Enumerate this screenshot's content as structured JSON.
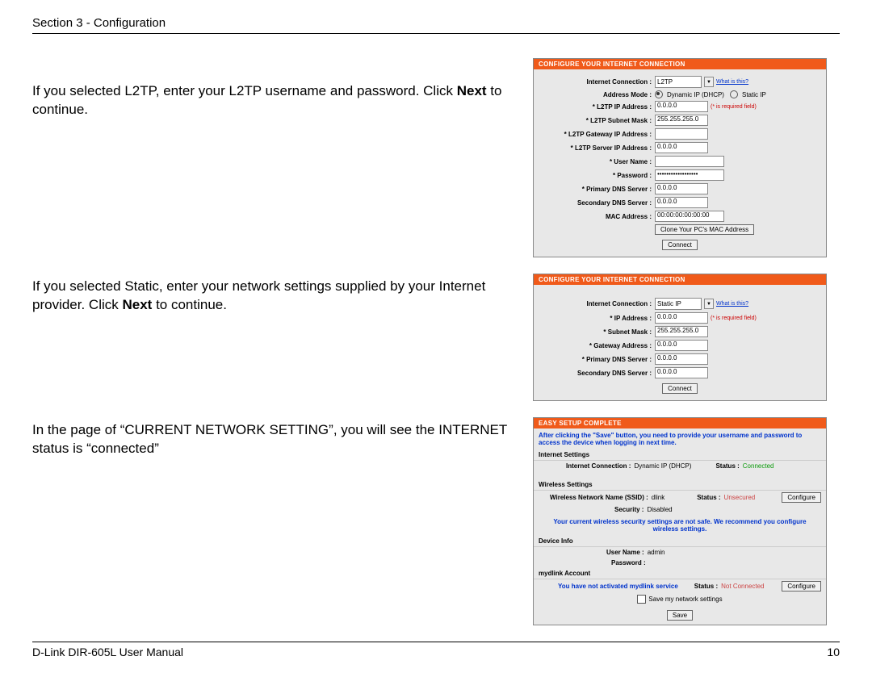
{
  "header": {
    "section": "Section 3 - Configuration"
  },
  "footer": {
    "manual": "D-Link DIR-605L User Manual",
    "page": "10"
  },
  "instructions": {
    "l2tp_a": "If you selected L2TP, enter your L2TP username and password. Click ",
    "l2tp_b": "Next",
    "l2tp_c": " to continue.",
    "static_a": "If you selected Static, enter your network settings supplied by your Internet provider. Click ",
    "static_b": "Next",
    "static_c": " to continue.",
    "current": "In the page of “CURRENT NETWORK SETTING”, you will see the INTERNET status is “connected”"
  },
  "panel1": {
    "title": "CONFIGURE YOUR INTERNET CONNECTION",
    "labels": {
      "internet_connection": "Internet Connection :",
      "address_mode": "Address Mode :",
      "l2tp_ip": "* L2TP IP Address :",
      "l2tp_subnet": "* L2TP Subnet Mask :",
      "l2tp_gateway": "* L2TP Gateway IP Address :",
      "l2tp_server": "* L2TP Server IP Address :",
      "username": "* User Name :",
      "password": "* Password :",
      "primary_dns": "* Primary DNS Server :",
      "secondary_dns": "Secondary DNS Server :",
      "mac": "MAC Address :"
    },
    "values": {
      "internet_connection": "L2TP",
      "what_is_this": "What is this?",
      "dynamic_ip": "Dynamic IP (DHCP)",
      "static_ip": "Static IP",
      "l2tp_ip": "0.0.0.0",
      "required": "(* is required field)",
      "l2tp_subnet": "255.255.255.0",
      "l2tp_gateway": "",
      "l2tp_server": "0.0.0.0",
      "username": "",
      "password": "••••••••••••••••••",
      "primary_dns": "0.0.0.0",
      "secondary_dns": "0.0.0.0",
      "mac": "00:00:00:00:00:00",
      "clone_btn": "Clone Your PC's MAC Address",
      "connect_btn": "Connect"
    }
  },
  "panel2": {
    "title": "CONFIGURE YOUR INTERNET CONNECTION",
    "labels": {
      "internet_connection": "Internet Connection :",
      "ip": "* IP Address :",
      "subnet": "* Subnet Mask :",
      "gateway": "* Gateway Address :",
      "primary_dns": "* Primary DNS Server :",
      "secondary_dns": "Secondary DNS Server :"
    },
    "values": {
      "internet_connection": "Static IP",
      "what_is_this": "What is this?",
      "ip": "0.0.0.0",
      "required": "(* is required field)",
      "subnet": "255.255.255.0",
      "gateway": "0.0.0.0",
      "primary_dns": "0.0.0.0",
      "secondary_dns": "0.0.0.0",
      "connect_btn": "Connect"
    }
  },
  "panel3": {
    "title": "EASY SETUP COMPLETE",
    "note": "After clicking the \"Save\" button, you need to provide your username and password to access the device when logging in next time.",
    "internet_settings": {
      "heading": "Internet Settings",
      "conn_label": "Internet Connection :",
      "conn_value": "Dynamic IP (DHCP)",
      "status_label": "Status :",
      "status_value": "Connected"
    },
    "wireless_settings": {
      "heading": "Wireless Settings",
      "ssid_label": "Wireless Network Name (SSID) :",
      "ssid_value": "dlink",
      "status_label": "Status :",
      "status_value": "Unsecured",
      "configure_btn": "Configure",
      "security_label": "Security :",
      "security_value": "Disabled",
      "warning": "Your current wireless security settings are not safe. We recommend you configure wireless settings."
    },
    "device_info": {
      "heading": "Device Info",
      "username_label": "User Name :",
      "username_value": "admin",
      "password_label": "Password :",
      "password_value": ""
    },
    "mydlink": {
      "heading": "mydlink Account",
      "not_activated": "You have not activated mydlink service",
      "status_label": "Status :",
      "status_value": "Not Connected",
      "configure_btn": "Configure",
      "save_settings": "Save my network settings",
      "save_btn": "Save"
    }
  }
}
